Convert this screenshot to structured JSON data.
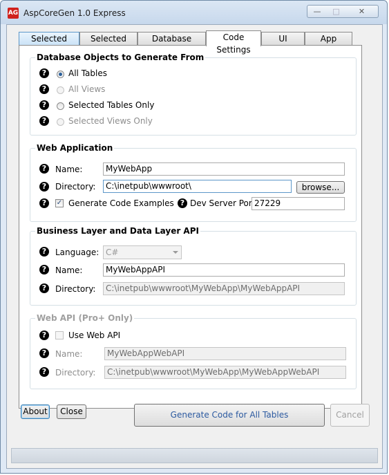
{
  "window": {
    "icon_text": "AG",
    "title": "AspCoreGen 1.0 Express"
  },
  "tabs": [
    {
      "label": "Selected Tables"
    },
    {
      "label": "Selected Views"
    },
    {
      "label": "Database Settings"
    },
    {
      "label": "Code Settings",
      "active": true
    },
    {
      "label": "UI Settings"
    },
    {
      "label": "App Settings"
    }
  ],
  "db_objects": {
    "title": "Database Objects to Generate From",
    "options": [
      {
        "label": "All Tables",
        "selected": true,
        "enabled": true
      },
      {
        "label": "All Views",
        "selected": false,
        "enabled": false
      },
      {
        "label": "Selected Tables Only",
        "selected": false,
        "enabled": true
      },
      {
        "label": "Selected Views Only",
        "selected": false,
        "enabled": false
      }
    ]
  },
  "web_app": {
    "title": "Web Application",
    "name_label": "Name:",
    "name_value": "MyWebApp",
    "directory_label": "Directory:",
    "directory_value": "C:\\inetpub\\wwwroot\\",
    "browse_label": "browse...",
    "gen_examples_label": "Generate Code Examples",
    "gen_examples_checked": true,
    "port_label": "Dev Server Port:",
    "port_value": "27229"
  },
  "business_layer": {
    "title": "Business Layer and Data Layer API",
    "language_label": "Language:",
    "language_value": "C#",
    "name_label": "Name:",
    "name_value": "MyWebAppAPI",
    "directory_label": "Directory:",
    "directory_value": "C:\\inetpub\\wwwroot\\MyWebApp\\MyWebAppAPI"
  },
  "web_api": {
    "title": "Web API (Pro+ Only)",
    "use_label": "Use Web API",
    "use_checked": false,
    "name_label": "Name:",
    "name_value": "MyWebAppWebAPI",
    "directory_label": "Directory:",
    "directory_value": "C:\\inetpub\\wwwroot\\MyWebApp\\MyWebAppWebAPI"
  },
  "footer": {
    "about_label": "About",
    "close_label": "Close",
    "generate_label": "Generate Code for All Tables",
    "cancel_label": "Cancel"
  },
  "help_glyph": "?"
}
